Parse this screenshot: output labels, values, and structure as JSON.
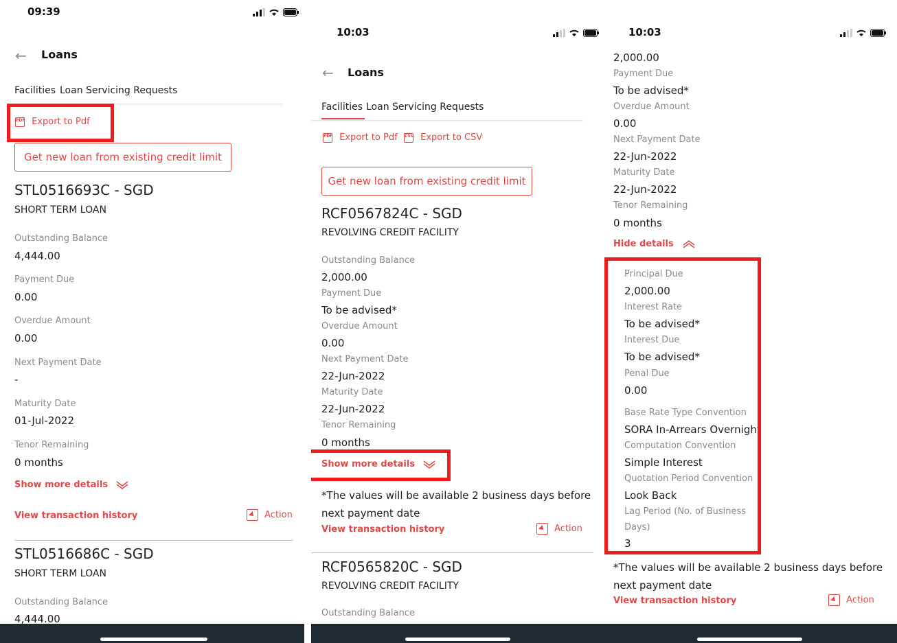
{
  "colors": {
    "accent": "#e04848",
    "highlight": "#ef1c1c",
    "home_bar": "#1f2a33"
  },
  "screens": [
    {
      "time": "09:39",
      "back_icon": "back-arrow-icon",
      "title": "Loans",
      "tab_facilities": "Facilities",
      "tab_requests": "Loan Servicing Requests",
      "export_pdf": "Export to Pdf",
      "new_loan_button": "Get new loan from existing credit limit",
      "loan1": {
        "account": "STL0516693C - SGD",
        "type": "SHORT TERM LOAN",
        "fields": [
          {
            "label": "Outstanding Balance",
            "value": "4,444.00"
          },
          {
            "label": "Payment Due",
            "value": "0.00"
          },
          {
            "label": "Overdue Amount",
            "value": "0.00"
          },
          {
            "label": "Next Payment Date",
            "value": "-"
          },
          {
            "label": "Maturity Date",
            "value": "01-Jul-2022"
          },
          {
            "label": "Tenor Remaining",
            "value": "0 months"
          }
        ]
      },
      "show_more": "Show more details",
      "view_history": "View transaction history",
      "action": "Action",
      "loan2": {
        "account": "STL0516686C - SGD",
        "type": "SHORT TERM LOAN",
        "fields": [
          {
            "label": "Outstanding Balance",
            "value": "4,444.00"
          }
        ]
      }
    },
    {
      "time": "10:03",
      "title": "Loans",
      "tab_facilities": "Facilities",
      "tab_requests": "Loan Servicing Requests",
      "export_pdf": "Export to Pdf",
      "export_csv": "Export to CSV",
      "new_loan_button": "Get new loan from existing credit limit",
      "loan1": {
        "account": "RCF0567824C - SGD",
        "type": "REVOLVING CREDIT FACILITY",
        "fields": [
          {
            "label": "Outstanding Balance",
            "value": "2,000.00"
          },
          {
            "label": "Payment Due",
            "value": "To be advised*"
          },
          {
            "label": "Overdue Amount",
            "value": "0.00"
          },
          {
            "label": "Next Payment Date",
            "value": "22-Jun-2022"
          },
          {
            "label": "Maturity Date",
            "value": "22-Jun-2022"
          },
          {
            "label": "Tenor Remaining",
            "value": "0 months"
          }
        ]
      },
      "show_more": "Show more details",
      "note_line1": "*The values will be available 2 business days before",
      "note_line2": "next payment date",
      "view_history": "View transaction history",
      "action": "Action",
      "loan2": {
        "account": "RCF0565820C - SGD",
        "type": "REVOLVING CREDIT FACILITY",
        "fields": [
          {
            "label": "Outstanding Balance"
          }
        ]
      }
    },
    {
      "time": "10:03",
      "top_value": "2,000.00",
      "fields": [
        {
          "label": "Payment Due",
          "value": "To be advised*"
        },
        {
          "label": "Overdue Amount",
          "value": "0.00"
        },
        {
          "label": "Next Payment Date",
          "value": "22-Jun-2022"
        },
        {
          "label": "Maturity Date",
          "value": "22-Jun-2022"
        },
        {
          "label": "Tenor Remaining",
          "value": "0 months"
        }
      ],
      "hide_details": "Hide details",
      "details": [
        {
          "label": "Principal Due",
          "value": "2,000.00"
        },
        {
          "label": "Interest Rate",
          "value": "To be advised*"
        },
        {
          "label": "Interest Due",
          "value": "To be advised*"
        },
        {
          "label": "Penal Due",
          "value": "0.00"
        },
        {
          "label": "Base Rate Type Convention",
          "value": "SORA In-Arrears Overnight"
        },
        {
          "label": "Computation Convention",
          "value": "Simple Interest"
        },
        {
          "label": "Quotation Period Convention",
          "value": "Look Back"
        },
        {
          "label_line1": "Lag Period (No. of Business",
          "label_line2": "Days)",
          "value": "3"
        }
      ],
      "note_line1": "*The values will be available 2 business days before",
      "note_line2": "next payment date",
      "view_history": "View transaction history",
      "action": "Action"
    }
  ]
}
